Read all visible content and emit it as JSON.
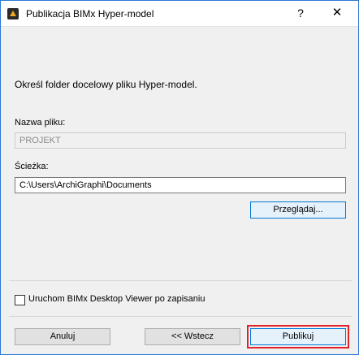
{
  "window": {
    "title": "Publikacja BIMx Hyper-model",
    "help_glyph": "?",
    "close_glyph": "✕"
  },
  "instruction": "Określ folder docelowy pliku Hyper-model.",
  "filename": {
    "label": "Nazwa pliku:",
    "value": "PROJEKT"
  },
  "path": {
    "label": "Ścieżka:",
    "value": "C:\\Users\\ArchiGraphi\\Documents",
    "browse_label": "Przeglądaj..."
  },
  "launch_viewer": {
    "label": "Uruchom BIMx Desktop Viewer po zapisaniu",
    "checked": false
  },
  "buttons": {
    "cancel": "Anuluj",
    "back": "<< Wstecz",
    "publish": "Publikuj"
  },
  "colors": {
    "accent": "#0078d7",
    "highlight": "#e3212b"
  }
}
